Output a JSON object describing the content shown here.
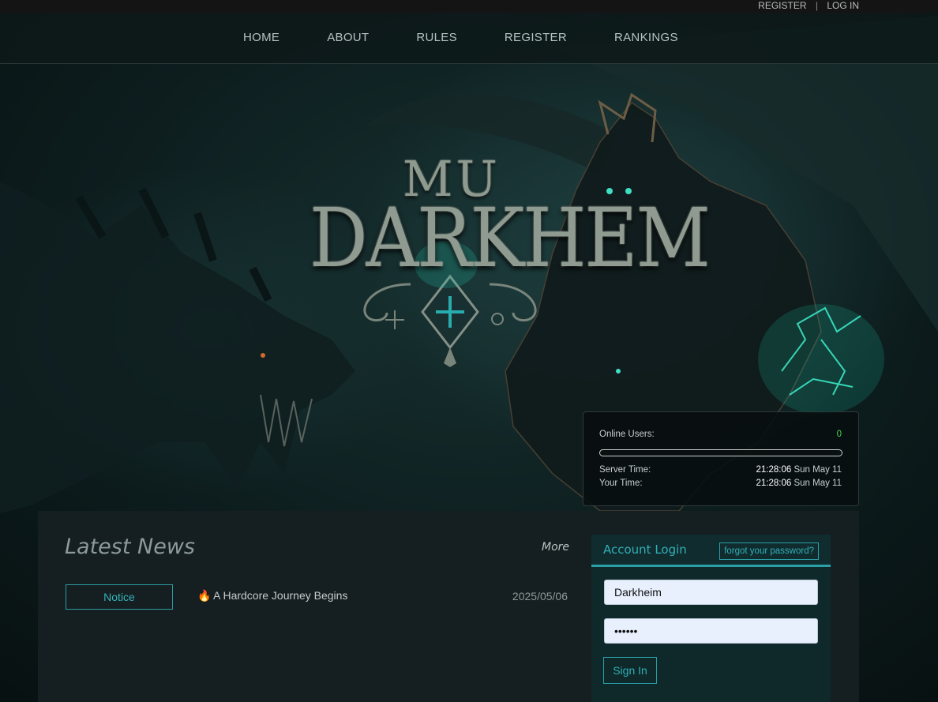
{
  "top_links": {
    "register": "REGISTER",
    "separator": "|",
    "login": "LOG IN"
  },
  "nav": {
    "items": [
      {
        "label": "HOME"
      },
      {
        "label": "ABOUT"
      },
      {
        "label": "RULES"
      },
      {
        "label": "REGISTER"
      },
      {
        "label": "RANKINGS"
      }
    ]
  },
  "logo": {
    "line1": "MU",
    "line2": "DARKHEM"
  },
  "status": {
    "online_label": "Online Users:",
    "online_count": "0",
    "server_time_label": "Server Time:",
    "server_time": "21:28:06",
    "server_date": "Sun May 11",
    "your_time_label": "Your Time:",
    "your_time": "21:28:06",
    "your_date": "Sun May 11",
    "online_fill_fraction": 0
  },
  "news": {
    "title": "Latest News",
    "more": "More",
    "items": [
      {
        "badge": "Notice",
        "icon": "fire-icon",
        "headline": "A Hardcore Journey Begins",
        "date": "2025/05/06"
      }
    ]
  },
  "login": {
    "title": "Account Login",
    "forgot": "forgot your password?",
    "username_value": "Darkheim",
    "password_value": "••••••",
    "submit": "Sign In"
  },
  "colors": {
    "accent": "#2a9fa6",
    "online_green": "#48d24f",
    "panel_bg": "#151e20",
    "login_bg": "#0f2829"
  }
}
